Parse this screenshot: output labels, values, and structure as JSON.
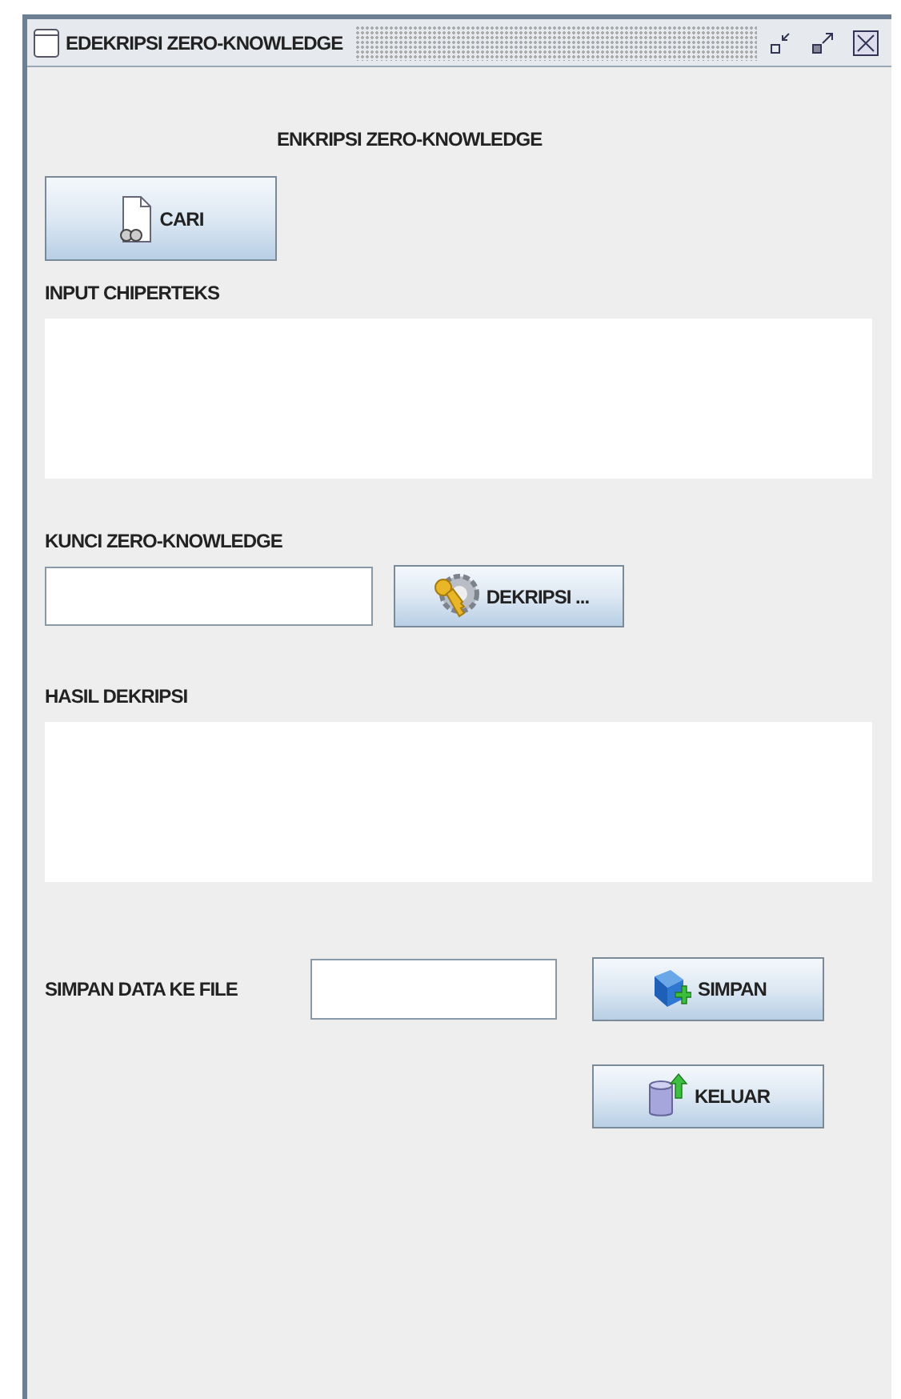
{
  "window": {
    "title": "EDEKRIPSI ZERO-KNOWLEDGE"
  },
  "heading": "ENKRIPSI ZERO-KNOWLEDGE",
  "search_button": {
    "label": "CARI"
  },
  "ciphertext": {
    "label": "INPUT CHIPERTEKS"
  },
  "key": {
    "label": "KUNCI ZERO-KNOWLEDGE"
  },
  "decrypt_button": {
    "label": "DEKRIPSI ..."
  },
  "result": {
    "label": "HASIL DEKRIPSI"
  },
  "save": {
    "label": "SIMPAN DATA KE FILE",
    "button": "SIMPAN"
  },
  "exit_button": {
    "label": "KELUAR"
  }
}
